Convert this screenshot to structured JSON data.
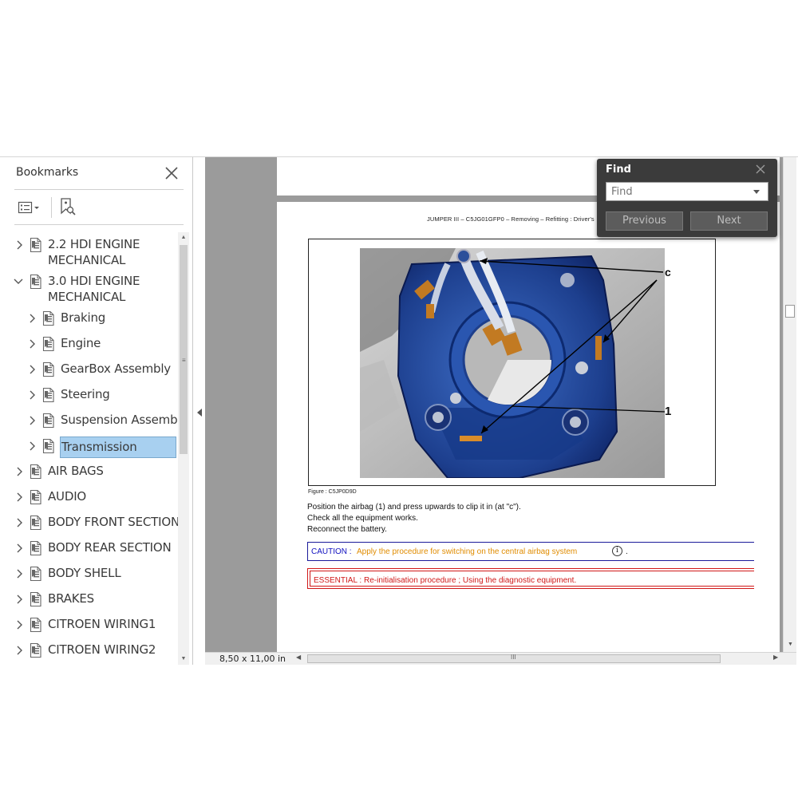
{
  "bookmarks": {
    "title": "Bookmarks",
    "items": [
      {
        "label_line1": "2.2 HDI ENGINE",
        "label_line2": "MECHANICAL",
        "level": 0,
        "expanded": false
      },
      {
        "label_line1": "3.0 HDI ENGINE",
        "label_line2": "MECHANICAL",
        "level": 0,
        "expanded": true
      },
      {
        "label": "Braking",
        "level": 1,
        "expanded": false
      },
      {
        "label": "Engine",
        "level": 1,
        "expanded": false
      },
      {
        "label": "GearBox Assembly",
        "level": 1,
        "expanded": false
      },
      {
        "label": "Steering",
        "level": 1,
        "expanded": false
      },
      {
        "label": "Suspension Assembly",
        "level": 1,
        "expanded": false
      },
      {
        "label": "Transmission",
        "level": 1,
        "expanded": false,
        "selected": true
      },
      {
        "label": "AIR BAGS",
        "level": 0,
        "expanded": false
      },
      {
        "label": "AUDIO",
        "level": 0,
        "expanded": false
      },
      {
        "label": "BODY FRONT SECTION",
        "level": 0,
        "expanded": false
      },
      {
        "label": "BODY REAR SECTION",
        "level": 0,
        "expanded": false
      },
      {
        "label": "BODY SHELL",
        "level": 0,
        "expanded": false
      },
      {
        "label": "BRAKES",
        "level": 0,
        "expanded": false
      },
      {
        "label": "CITROEN WIRING1",
        "level": 0,
        "expanded": false
      },
      {
        "label": "CITROEN WIRING2",
        "level": 0,
        "expanded": false
      }
    ]
  },
  "document": {
    "header": "JUMPER III – C5JG01GFP0 – Removing – Refitting : Driver's",
    "figure_labels": {
      "c": "c",
      "one": "1"
    },
    "figure_caption": "Figure : C5JP0D9D",
    "instructions": [
      "Position the airbag (1) and press upwards to clip it in (at \"c\").",
      "Check all the equipment works.",
      "Reconnect the battery."
    ],
    "caution_label": "CAUTION : ",
    "caution_text": "Apply the procedure for switching on the central airbag system",
    "caution_info": "i",
    "caution_end": ".",
    "essential_text": "ESSENTIAL : Re-initialisation procedure ; Using the diagnostic equipment."
  },
  "status": {
    "page_size": "8,50 x 11,00 in",
    "h_grip": "III"
  },
  "find": {
    "title": "Find",
    "placeholder": "Find",
    "previous_label": "Previous",
    "next_label": "Next"
  },
  "colors": {
    "caution_blue": "#1010c0",
    "caution_orange": "#e08c00",
    "essential_red": "#d01818",
    "selection": "#a8d0f0",
    "find_bg": "#3b3b3b",
    "doc_bg": "#9b9b9b"
  }
}
